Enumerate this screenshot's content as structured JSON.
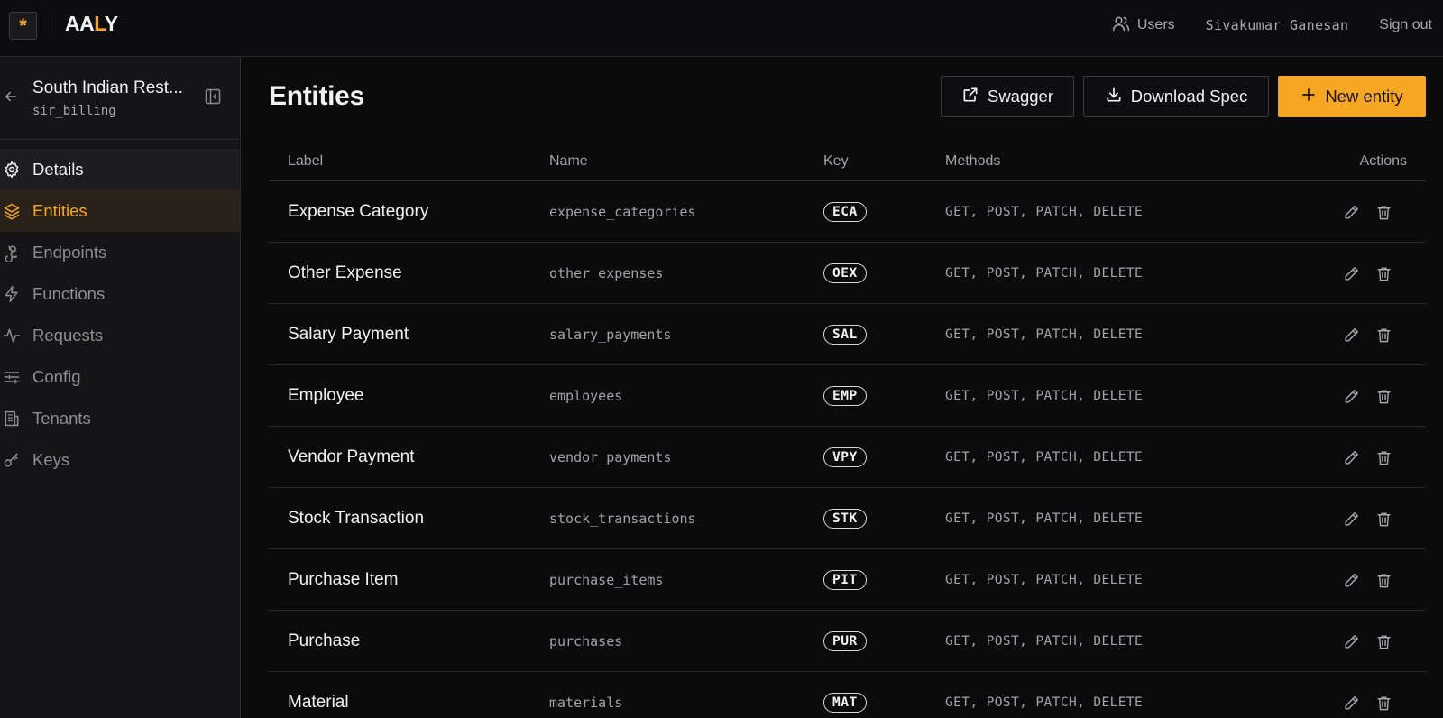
{
  "topbar": {
    "logo_glyph": "*",
    "brand_main": "AA",
    "brand_accent": "L",
    "brand_tail": "Y",
    "users_label": "Users",
    "user_name": "Sivakumar Ganesan",
    "signout_label": "Sign out"
  },
  "sidebar": {
    "project_name": "South Indian Rest...",
    "project_slug": "sir_billing",
    "items": [
      {
        "label": "Details",
        "icon": "gear-icon",
        "state": "hover"
      },
      {
        "label": "Entities",
        "icon": "layers-icon",
        "state": "active"
      },
      {
        "label": "Endpoints",
        "icon": "webhook-icon",
        "state": ""
      },
      {
        "label": "Functions",
        "icon": "bolt-icon",
        "state": ""
      },
      {
        "label": "Requests",
        "icon": "activity-icon",
        "state": ""
      },
      {
        "label": "Config",
        "icon": "sliders-icon",
        "state": ""
      },
      {
        "label": "Tenants",
        "icon": "building-icon",
        "state": ""
      },
      {
        "label": "Keys",
        "icon": "key-icon",
        "state": ""
      }
    ]
  },
  "main": {
    "title": "Entities",
    "swagger_label": "Swagger",
    "download_label": "Download Spec",
    "new_label": "New entity",
    "columns": {
      "label": "Label",
      "name": "Name",
      "key": "Key",
      "methods": "Methods",
      "actions": "Actions"
    },
    "rows": [
      {
        "label": "Expense Category",
        "name": "expense_categories",
        "key": "ECA",
        "methods": "GET, POST, PATCH, DELETE"
      },
      {
        "label": "Other Expense",
        "name": "other_expenses",
        "key": "OEX",
        "methods": "GET, POST, PATCH, DELETE"
      },
      {
        "label": "Salary Payment",
        "name": "salary_payments",
        "key": "SAL",
        "methods": "GET, POST, PATCH, DELETE"
      },
      {
        "label": "Employee",
        "name": "employees",
        "key": "EMP",
        "methods": "GET, POST, PATCH, DELETE"
      },
      {
        "label": "Vendor Payment",
        "name": "vendor_payments",
        "key": "VPY",
        "methods": "GET, POST, PATCH, DELETE"
      },
      {
        "label": "Stock Transaction",
        "name": "stock_transactions",
        "key": "STK",
        "methods": "GET, POST, PATCH, DELETE"
      },
      {
        "label": "Purchase Item",
        "name": "purchase_items",
        "key": "PIT",
        "methods": "GET, POST, PATCH, DELETE"
      },
      {
        "label": "Purchase",
        "name": "purchases",
        "key": "PUR",
        "methods": "GET, POST, PATCH, DELETE"
      },
      {
        "label": "Material",
        "name": "materials",
        "key": "MAT",
        "methods": "GET, POST, PATCH, DELETE"
      }
    ]
  },
  "colors": {
    "accent": "#f5a623",
    "background": "#0b0b0c",
    "sidebar": "#151518",
    "active_bg": "#2a2219"
  }
}
